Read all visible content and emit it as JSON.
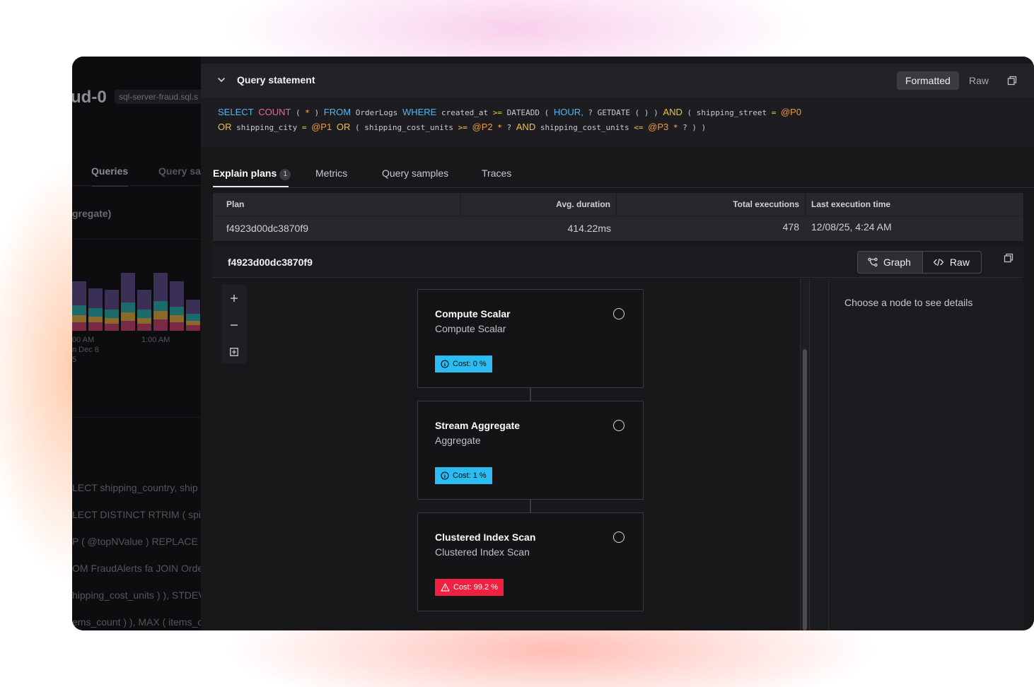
{
  "background_app": {
    "title_fragment": "ud-0",
    "host_fragment": "sql-server-fraud.sql.s",
    "tabs": [
      "Queries",
      "Query sa"
    ],
    "aggregate_fragment": "gregate)",
    "chart_ticks": [
      "00 AM",
      "1:00 AM"
    ],
    "chart_tick_sub": [
      "n Dec 8",
      "5"
    ],
    "queries": [
      "LECT shipping_country, ship",
      "LECT DISTINCT RTRIM ( spi.c",
      "P ( @topNValue ) REPLACE (",
      "OM FraudAlerts fa JOIN Orde",
      "hipping_cost_units ) ), STDEV",
      "ems_count ) ), MAX ( items_c"
    ]
  },
  "query_statement": {
    "title": "Query statement",
    "formatted_label": "Formatted",
    "raw_label": "Raw",
    "sql_line1": [
      {
        "t": "SELECT",
        "c": "kw"
      },
      {
        "t": " ",
        "c": ""
      },
      {
        "t": "COUNT",
        "c": "fn"
      },
      {
        "t": " ( ",
        "c": ""
      },
      {
        "t": "*",
        "c": "op"
      },
      {
        "t": " ) ",
        "c": ""
      },
      {
        "t": "FROM",
        "c": "kw"
      },
      {
        "t": " OrderLogs ",
        "c": ""
      },
      {
        "t": "WHERE",
        "c": "kw"
      },
      {
        "t": " created_at ",
        "c": ""
      },
      {
        "t": ">=",
        "c": "op"
      },
      {
        "t": " DATEADD ( ",
        "c": ""
      },
      {
        "t": "HOUR,",
        "c": "hr"
      },
      {
        "t": " ? GETDATE ( ) ) ",
        "c": ""
      },
      {
        "t": "AND",
        "c": "kwy"
      },
      {
        "t": " ( shipping_street ",
        "c": ""
      },
      {
        "t": "=",
        "c": "op"
      },
      {
        "t": " ",
        "c": ""
      },
      {
        "t": "@P0",
        "c": "pm"
      }
    ],
    "sql_line2": [
      {
        "t": "OR",
        "c": "kwy"
      },
      {
        "t": " shipping_city ",
        "c": ""
      },
      {
        "t": "=",
        "c": "op"
      },
      {
        "t": " ",
        "c": ""
      },
      {
        "t": "@P1",
        "c": "pm"
      },
      {
        "t": " ",
        "c": ""
      },
      {
        "t": "OR",
        "c": "kwy"
      },
      {
        "t": " ( shipping_cost_units ",
        "c": ""
      },
      {
        "t": ">=",
        "c": "op"
      },
      {
        "t": " ",
        "c": ""
      },
      {
        "t": "@P2",
        "c": "pm"
      },
      {
        "t": " ",
        "c": ""
      },
      {
        "t": "*",
        "c": "op"
      },
      {
        "t": " ? ",
        "c": ""
      },
      {
        "t": "AND",
        "c": "kwy"
      },
      {
        "t": " shipping_cost_units ",
        "c": ""
      },
      {
        "t": "<=",
        "c": "op"
      },
      {
        "t": " ",
        "c": ""
      },
      {
        "t": "@P3",
        "c": "pm"
      },
      {
        "t": " ",
        "c": ""
      },
      {
        "t": "*",
        "c": "op"
      },
      {
        "t": " ? ) )",
        "c": ""
      }
    ]
  },
  "tabs": {
    "explain_plans": "Explain plans",
    "explain_plans_count": "1",
    "metrics": "Metrics",
    "query_samples": "Query samples",
    "traces": "Traces"
  },
  "plans_table": {
    "headers": [
      "Plan",
      "Avg. duration",
      "Total executions",
      "Last execution time"
    ],
    "row": {
      "plan": "f4923d00dc3870f9",
      "avg_duration": "414.22ms",
      "total_executions": "478",
      "last_execution": "12/08/25, 4:24 AM"
    }
  },
  "plan_detail": {
    "plan_id": "f4923d00dc3870f9",
    "graph_label": "Graph",
    "raw_label": "Raw",
    "details_placeholder": "Choose a node to see details",
    "nodes": [
      {
        "title": "Compute Scalar",
        "subtitle": "Compute Scalar",
        "cost": "Cost: 0 %",
        "level": "info"
      },
      {
        "title": "Stream Aggregate",
        "subtitle": "Aggregate",
        "cost": "Cost: 1 %",
        "level": "info"
      },
      {
        "title": "Clustered Index Scan",
        "subtitle": "Clustered Index Scan",
        "cost": "Cost: 99.2 %",
        "level": "warn"
      }
    ]
  },
  "colors": {
    "info_badge": "#2bbcf2",
    "warn_badge": "#f02040",
    "sql_keyword": "#4fb8f0",
    "sql_function": "#e06a9b",
    "sql_param": "#f09a3a"
  }
}
